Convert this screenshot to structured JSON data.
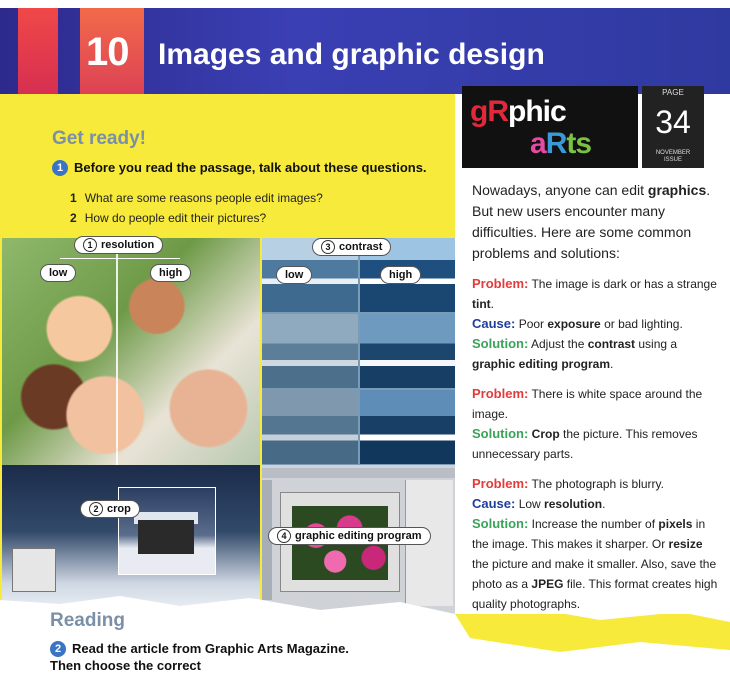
{
  "header": {
    "unit_number": "10",
    "unit_title": "Images and graphic design"
  },
  "get_ready": {
    "heading": "Get ready!",
    "q_number": "1",
    "instruction": "Before you read the passage, talk about these questions.",
    "questions": [
      {
        "n": "1",
        "text": "What are some reasons people edit images?"
      },
      {
        "n": "2",
        "text": "How do people edit their pictures?"
      }
    ]
  },
  "labels": {
    "resolution_num": "1",
    "resolution": "resolution",
    "crop_num": "2",
    "crop": "crop",
    "contrast_num": "3",
    "contrast": "contrast",
    "editing_num": "4",
    "editing": "graphic editing program",
    "low": "low",
    "high": "high"
  },
  "reading": {
    "heading": "Reading",
    "q_number": "2",
    "instruction": "Read the article from Graphic Arts Magazine. Then choose the correct"
  },
  "magazine": {
    "masthead": {
      "l1": "gR",
      "l2": "a",
      "l3": "phic",
      "l4": "a",
      "l5": "R",
      "l6": "ts"
    },
    "issue_page_label": "PAGE",
    "issue_page": "34",
    "issue_month": "NOVEMBER",
    "issue_word": "ISSUE"
  },
  "article": {
    "intro_a": "Nowadays, anyone can edit ",
    "intro_b": "graphics",
    "intro_c": ". But new users encounter many difficulties. Here are some common problems and solutions:",
    "problem_label": "Problem:",
    "cause_label": "Cause:",
    "solution_label": "Solution:",
    "p1_problem_a": " The image is dark or has a strange ",
    "p1_problem_b": "tint",
    "p1_problem_c": ".",
    "p1_cause_a": " Poor ",
    "p1_cause_b": "exposure",
    "p1_cause_c": " or bad lighting.",
    "p1_solution_a": " Adjust the ",
    "p1_solution_b": "contrast",
    "p1_solution_c": " using a ",
    "p1_solution_d": "graphic editing program",
    "p1_solution_e": ".",
    "p2_problem": " There is white space around the image.",
    "p2_solution_a": " ",
    "p2_solution_b": "Crop",
    "p2_solution_c": " the picture. This removes unnecessary parts.",
    "p3_problem": " The photograph is blurry.",
    "p3_cause_a": " Low ",
    "p3_cause_b": "resolution",
    "p3_cause_c": ".",
    "p3_solution_a": " Increase the number of ",
    "p3_solution_b": "pixels",
    "p3_solution_c": " in the image. This makes it sharper. Or ",
    "p3_solution_d": "resize",
    "p3_solution_e": " the picture and make it smaller. Also, save the photo as a ",
    "p3_solution_f": "JPEG",
    "p3_solution_g": " file. This format creates high quality photographs."
  }
}
